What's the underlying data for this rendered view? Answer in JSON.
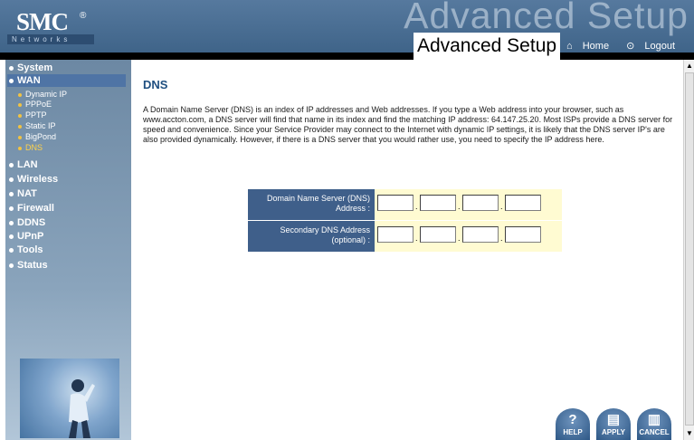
{
  "header": {
    "logo_main": "SMC",
    "logo_reg": "®",
    "logo_sub": "Networks",
    "background_title": "Advanced Setup",
    "title": "Advanced Setup",
    "home_label": "Home",
    "logout_label": "Logout",
    "home_icon": "house-icon",
    "logout_icon": "power-icon"
  },
  "sidebar": {
    "items": [
      {
        "label": "System"
      },
      {
        "label": "WAN"
      },
      {
        "label": "LAN"
      },
      {
        "label": "Wireless"
      },
      {
        "label": "NAT"
      },
      {
        "label": "Firewall"
      },
      {
        "label": "DDNS"
      },
      {
        "label": "UPnP"
      },
      {
        "label": "Tools"
      },
      {
        "label": "Status"
      }
    ],
    "wan_subitems": [
      {
        "label": "Dynamic IP"
      },
      {
        "label": "PPPoE"
      },
      {
        "label": "PPTP"
      },
      {
        "label": "Static IP"
      },
      {
        "label": "BigPond"
      },
      {
        "label": "DNS"
      }
    ]
  },
  "main": {
    "title": "DNS",
    "description": "A Domain Name Server (DNS) is an index of IP addresses and Web addresses. If you type a Web address into your browser, such as www.accton.com, a DNS server will find that name in its index and find the matching IP address: 64.147.25.20. Most ISPs provide a DNS server for speed and convenience. Since your Service Provider may connect to the Internet with dynamic IP settings, it is likely that the DNS server IP's are also provided dynamically. However, if there is a DNS server that you would rather use, you need to specify the IP address here.",
    "primary_label": "Domain Name Server (DNS) Address :",
    "secondary_label": "Secondary DNS Address (optional) :",
    "primary_octets": [
      "",
      "",
      "",
      ""
    ],
    "secondary_octets": [
      "",
      "",
      "",
      ""
    ],
    "octet_separator": "."
  },
  "buttons": {
    "help": "HELP",
    "apply": "APPLY",
    "cancel": "CANCEL"
  },
  "colors": {
    "header_bg": "#3f6489",
    "label_bg": "#3f5f8a",
    "field_bg": "#fffbd2",
    "title_color": "#1f4f80",
    "active_sub": "#ffd24a"
  }
}
